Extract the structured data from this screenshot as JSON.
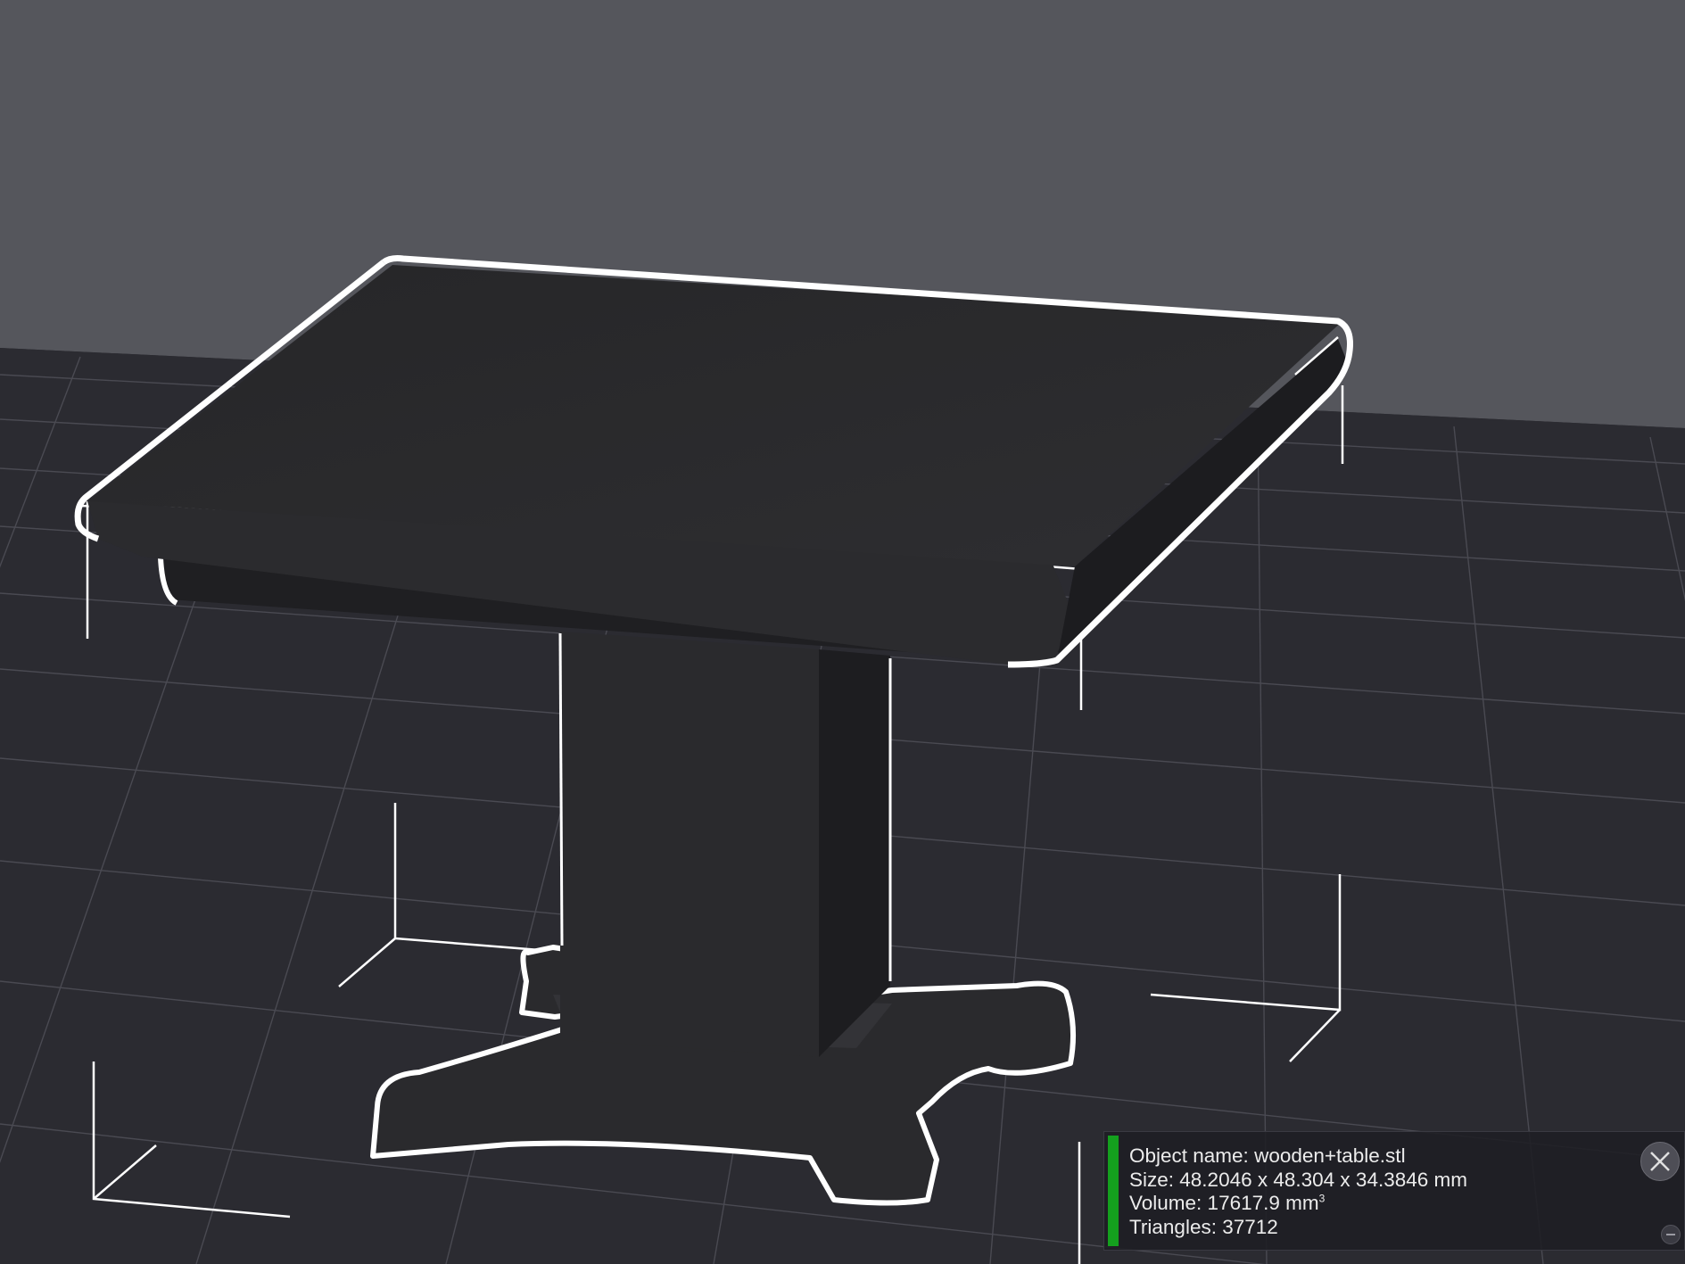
{
  "colors": {
    "sky": "#55565c",
    "floor": "#2b2b31",
    "grid": "#4a4a52",
    "model": "#2a2a2d",
    "outline": "#ffffff",
    "status": "#14a01e"
  },
  "info": {
    "object_name": "Object name: wooden+table.stl",
    "size": "Size: 48.2046 x 48.304 x 34.3846 mm",
    "volume": "Volume: 17617.9 mm",
    "volume_unit_power": "3",
    "triangles": "Triangles: 37712"
  },
  "icons": {
    "close": "close-icon",
    "collapse": "minus-icon"
  }
}
